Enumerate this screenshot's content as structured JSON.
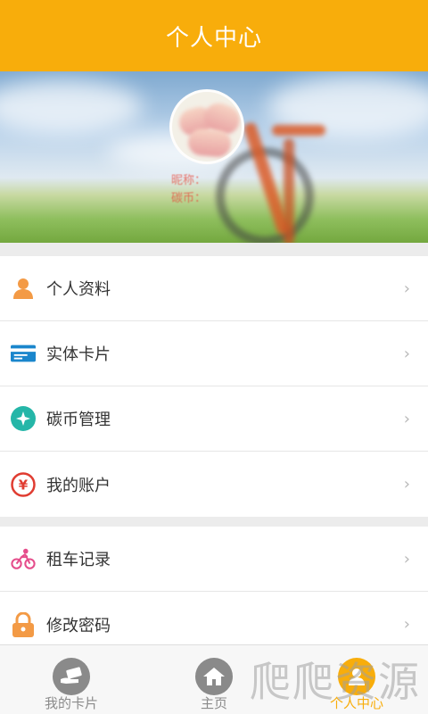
{
  "header": {
    "title": "个人中心"
  },
  "profile": {
    "nickname_label": "昵称：",
    "coins_label": "碳币："
  },
  "menu_group_1": [
    {
      "label": "个人资料",
      "icon": "person-icon",
      "color": "#f39a45"
    },
    {
      "label": "实体卡片",
      "icon": "card-icon",
      "color": "#1a86cc"
    },
    {
      "label": "碳币管理",
      "icon": "coin-icon",
      "color": "#25b6a8"
    },
    {
      "label": "我的账户",
      "icon": "yuan-icon",
      "color": "#e03c31"
    }
  ],
  "menu_group_2": [
    {
      "label": "租车记录",
      "icon": "cyclist-icon",
      "color": "#e54d8b"
    },
    {
      "label": "修改密码",
      "icon": "lock-icon",
      "color": "#f39a45"
    }
  ],
  "chevron": "›",
  "bottom_nav": [
    {
      "label": "我的卡片",
      "icon": "card-hand-icon",
      "active": false
    },
    {
      "label": "主页",
      "icon": "home-icon",
      "active": false
    },
    {
      "label": "个人中心",
      "icon": "person-center-icon",
      "active": true
    }
  ],
  "watermark": "爬爬资源",
  "colors": {
    "accent": "#f8ad0b",
    "text": "#333333",
    "chevron": "#b8b8b8"
  }
}
